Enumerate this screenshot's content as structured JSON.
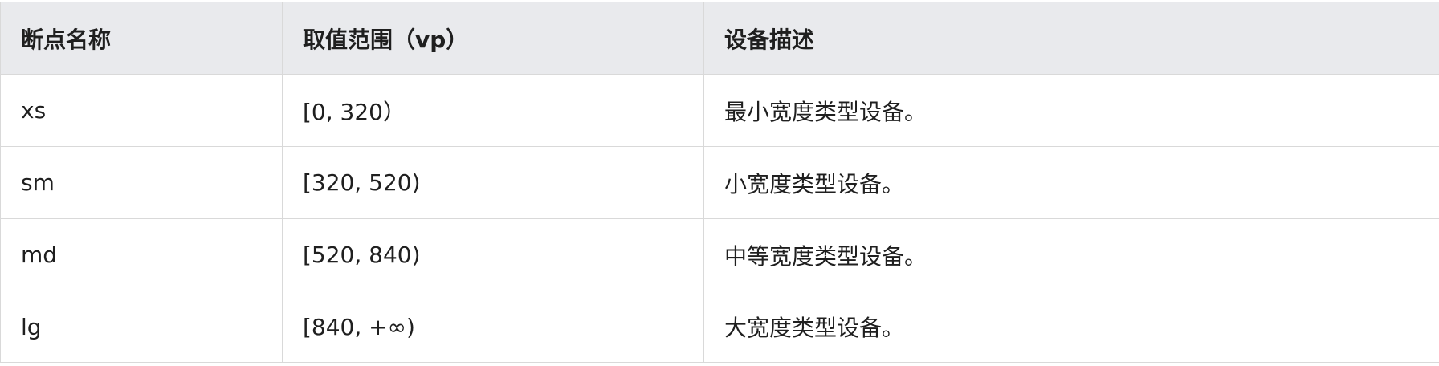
{
  "table": {
    "headers": [
      "断点名称",
      "取值范围（vp）",
      "设备描述"
    ],
    "rows": [
      [
        "xs",
        "[0, 320）",
        "最小宽度类型设备。"
      ],
      [
        "sm",
        "[320, 520)",
        "小宽度类型设备。"
      ],
      [
        "md",
        "[520, 840)",
        "中等宽度类型设备。"
      ],
      [
        "lg",
        "[840, +∞)",
        "大宽度类型设备。"
      ]
    ]
  }
}
